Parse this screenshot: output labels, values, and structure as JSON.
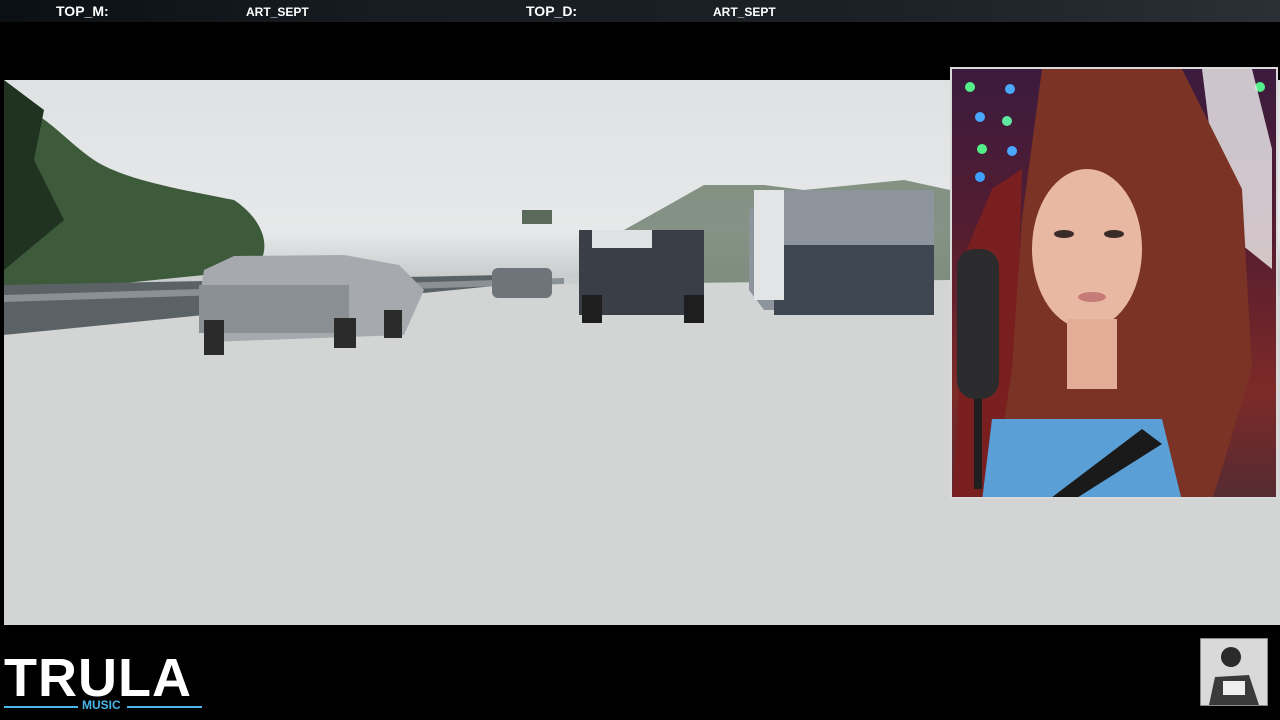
{
  "ticker": {
    "top_m_label": "TOP_M:",
    "top_m_value": "ART_SEPT",
    "top_d_label": "TOP_D:",
    "top_d_value": "ART_SEPT"
  },
  "brand": {
    "title": "TRULA",
    "subtitle": "MUSIC",
    "accent_color": "#49b6ea"
  },
  "icons": [
    "streamer-webcam",
    "channel-avatar"
  ]
}
